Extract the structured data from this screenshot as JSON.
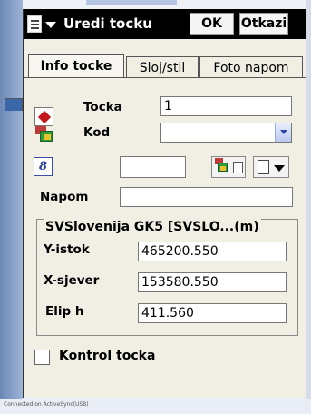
{
  "window": {
    "title": "Uredi tocku",
    "ok_label": "OK",
    "cancel_label": "Otkazi"
  },
  "tabs": [
    {
      "label": "Info tocke",
      "active": true
    },
    {
      "label": "Sloj/stil",
      "active": false
    },
    {
      "label": "Foto napom",
      "active": false
    }
  ],
  "point": {
    "label": "Tocka",
    "value": "1",
    "icon": "red-diamond-point-icon"
  },
  "code": {
    "label": "Kod",
    "value": "",
    "icon": "layers-code-icon"
  },
  "info_row": {
    "value": ""
  },
  "note": {
    "label": "Napom",
    "value": ""
  },
  "coordinates": {
    "system": "SVSlovenija GK5 [SVSLO...(m)",
    "fields": [
      {
        "label": "Y-istok",
        "value": "465200.550"
      },
      {
        "label": "X-sjever",
        "value": "153580.550"
      },
      {
        "label": "Elip h",
        "value": "411.560"
      }
    ]
  },
  "control": {
    "label": "Kontrol tocka",
    "checked": false
  },
  "status_text": "Connected on ActiveSync(USB)",
  "colors": {
    "titlebar": "#000000",
    "background": "#f1efe4",
    "accent_blue": "#2c4aa6",
    "point_red": "#c0161c"
  }
}
